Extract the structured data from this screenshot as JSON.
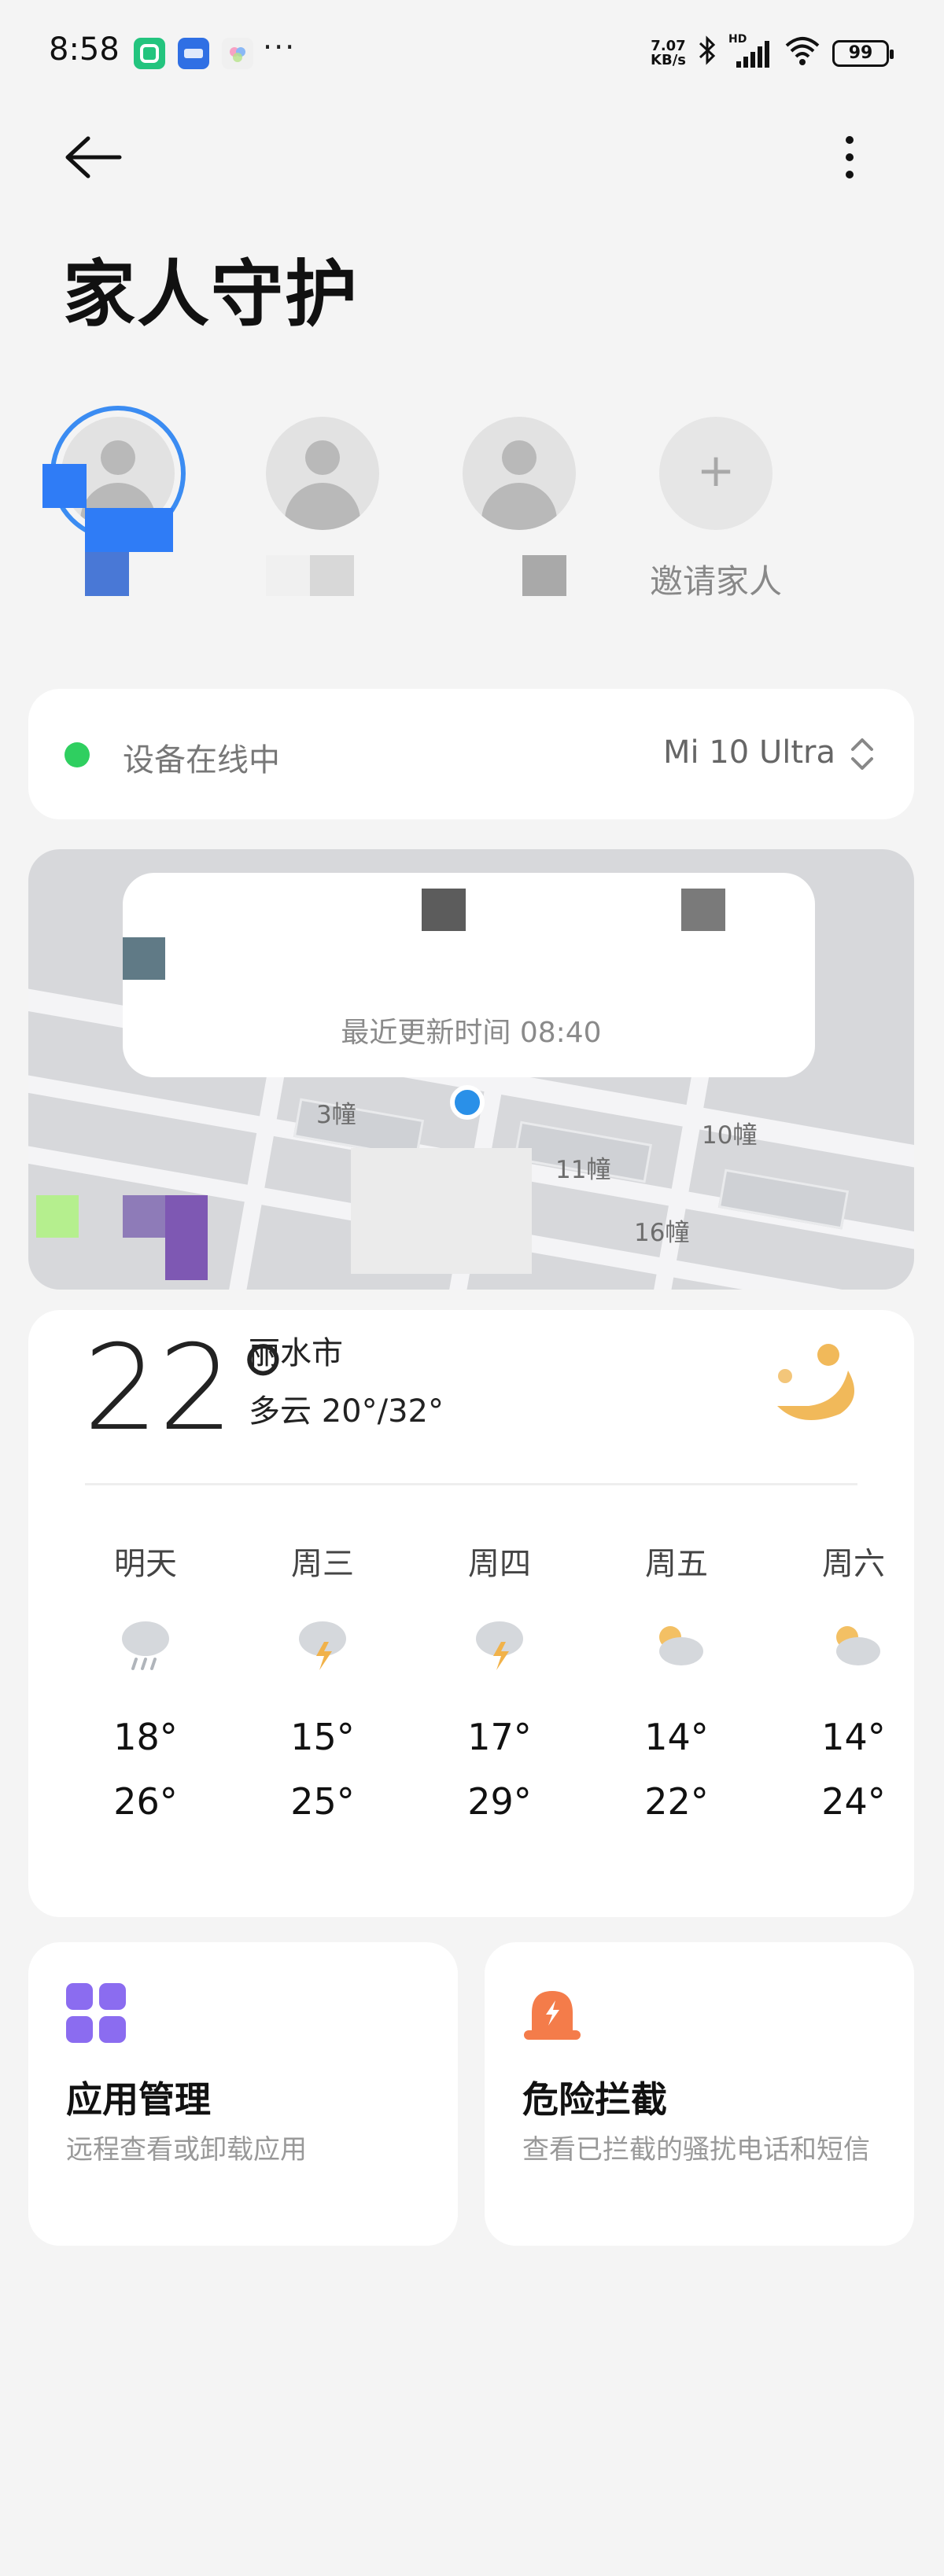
{
  "status_bar": {
    "time": "8:58",
    "net_speed_value": "7.07",
    "net_speed_unit": "KB/s",
    "hd_label": "HD",
    "battery": "99",
    "more_dots": "···"
  },
  "header": {
    "title": "家人守护"
  },
  "members": {
    "invite_symbol": "+",
    "invite_label": "邀请家人"
  },
  "device": {
    "status": "设备在线中",
    "name": "Mi 10 Ultra",
    "status_color": "#2fcf60"
  },
  "map": {
    "updated": "最近更新时间 08:40",
    "labels": [
      "3幢",
      "10幢",
      "11幢",
      "16幢"
    ]
  },
  "weather": {
    "temp": "22°",
    "city": "丽水市",
    "condition": "多云 20°/32°",
    "forecast": [
      {
        "day": "明天",
        "icon": "rain-cloud-icon",
        "low": "18°",
        "high": "26°"
      },
      {
        "day": "周三",
        "icon": "thunderstorm-icon",
        "low": "15°",
        "high": "25°"
      },
      {
        "day": "周四",
        "icon": "thunderstorm-icon",
        "low": "17°",
        "high": "29°"
      },
      {
        "day": "周五",
        "icon": "partly-cloudy-icon",
        "low": "14°",
        "high": "22°"
      },
      {
        "day": "周六",
        "icon": "partly-cloudy-icon",
        "low": "14°",
        "high": "24°"
      }
    ]
  },
  "tools": {
    "apps": {
      "title": "应用管理",
      "desc": "远程查看或卸载应用",
      "color": "#8b6cf0"
    },
    "danger": {
      "title": "危险拦截",
      "desc": "查看已拦截的骚扰电话和短信",
      "color": "#f47c4a"
    }
  }
}
